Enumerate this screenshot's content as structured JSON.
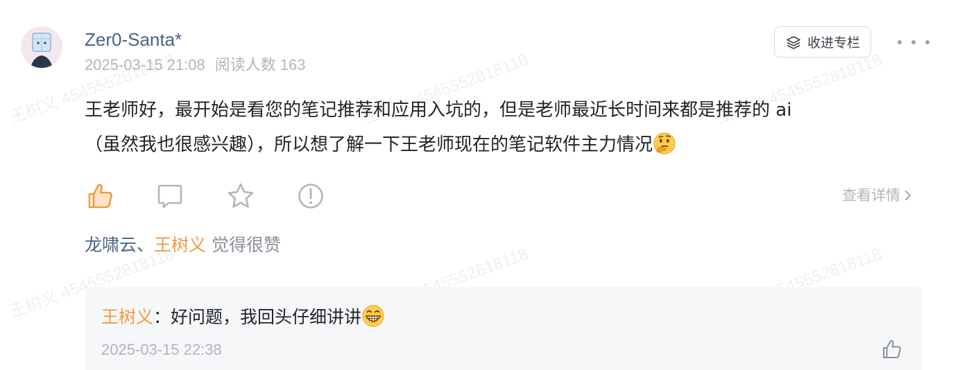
{
  "post": {
    "username": "Zer0-Santa*",
    "datetime": "2025-03-15 21:08",
    "read_count_label": "阅读人数 163",
    "content_line1": "王老师好，最开始是看您的笔记推荐和应用入坑的，但是老师最近长时间来都是推荐的 ai",
    "content_line2": "（虽然我也很感兴趣），所以想了解一下王老师现在的笔记软件主力情况",
    "content_emoji": "thinking-face"
  },
  "toolbar": {
    "collect_label": "收进专栏",
    "detail_label": "查看详情"
  },
  "likes": {
    "name1": "龙啸云",
    "separator": "、",
    "name2": "王树义",
    "suffix": "觉得很赞"
  },
  "reply": {
    "author": "王树义",
    "colon": "：",
    "text": "好问题，我回头仔细讲讲",
    "emoji": "grinning-face",
    "datetime": "2025-03-15 22:38"
  },
  "watermark": {
    "text": "王树义 4545552818118"
  },
  "colors": {
    "like_accent": "#f09a45",
    "username": "#4a6386",
    "muted": "#b1b5bd",
    "reply_bg": "#f6f7f9"
  }
}
